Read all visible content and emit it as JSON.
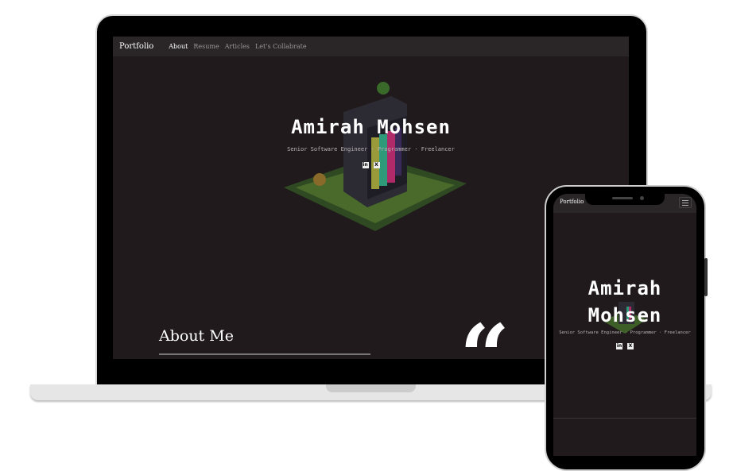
{
  "site": {
    "brand": "Portfolio",
    "nav": [
      {
        "label": "About",
        "active": true
      },
      {
        "label": "Resume"
      },
      {
        "label": "Articles"
      },
      {
        "label": "Let's Collabrate"
      }
    ]
  },
  "hero": {
    "name": "Amirah Mohsen",
    "name_line1": "Amirah",
    "name_line2": "Mohsen",
    "subtitle": "Senior Software Engineer · Programmer · Freelancer",
    "social": [
      {
        "icon": "linkedin-icon",
        "glyph": "in"
      },
      {
        "icon": "x-twitter-icon",
        "glyph": "X"
      }
    ]
  },
  "about": {
    "heading": "About Me",
    "quote_glyph": "“"
  },
  "colors": {
    "bg": "#201a1c",
    "nav": "#2a2627"
  }
}
